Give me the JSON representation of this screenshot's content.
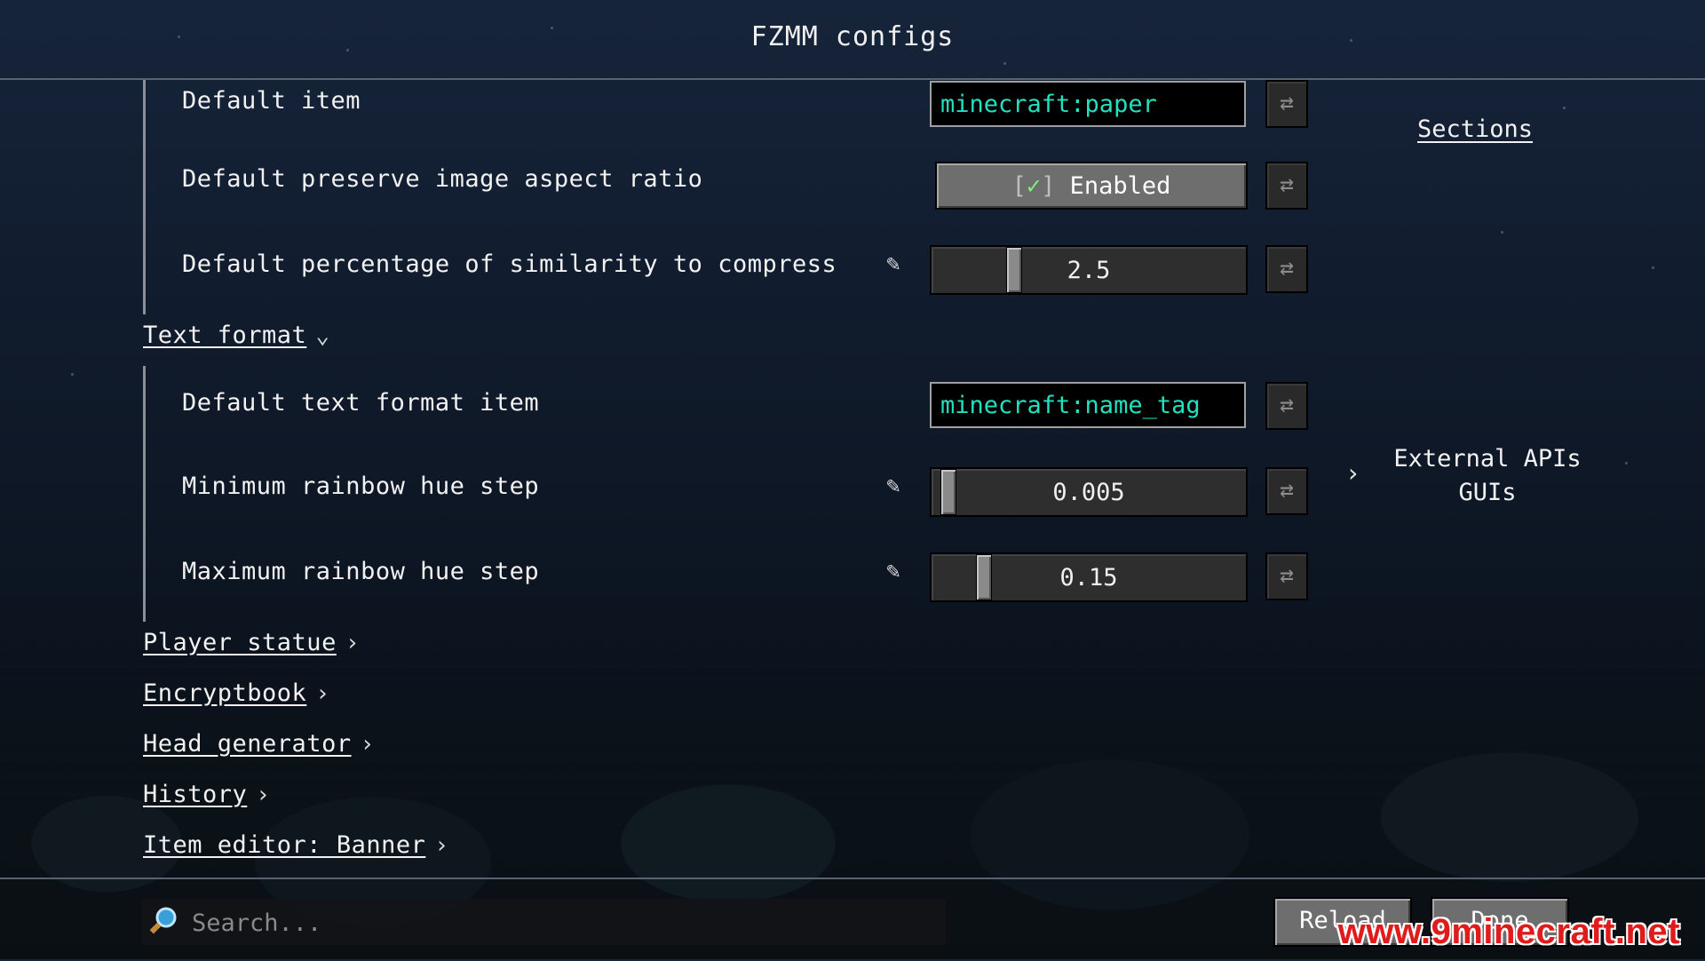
{
  "header": {
    "title": "FZMM configs"
  },
  "settings": {
    "default_item": {
      "label": "Default item",
      "value": "minecraft:paper"
    },
    "preserve_aspect": {
      "label": "Default preserve image aspect ratio",
      "check": "[",
      "mark": "✓",
      "check_end": "]",
      "value": "Enabled"
    },
    "similarity": {
      "label": "Default percentage of similarity to compress",
      "value": "2.5",
      "level": 0.25
    },
    "text_format_section": {
      "label": "Text format",
      "expanded": true
    },
    "default_text_item": {
      "label": "Default text format item",
      "value": "minecraft:name_tag"
    },
    "min_hue": {
      "label": "Minimum rainbow hue step",
      "value": "0.005",
      "level": 0.03
    },
    "max_hue": {
      "label": "Maximum rainbow hue step",
      "value": "0.15",
      "level": 0.15
    }
  },
  "sections": [
    {
      "label": "Player statue"
    },
    {
      "label": "Encryptbook"
    },
    {
      "label": "Head generator"
    },
    {
      "label": "History"
    },
    {
      "label": "Item editor: Banner"
    }
  ],
  "icons": {
    "reset": "reset-arrows-icon",
    "edit": "pencil-icon",
    "expand": "chevron-down-icon",
    "collapse": "chevron-right-icon",
    "search": "magnifier-icon"
  },
  "sidebar": {
    "title": "Sections",
    "item_line1": "External APIs",
    "item_line2": "GUIs"
  },
  "footer": {
    "search_placeholder": "Search...",
    "reload": "Reload",
    "done": "Done"
  },
  "watermark": "www.9minecraft.net"
}
